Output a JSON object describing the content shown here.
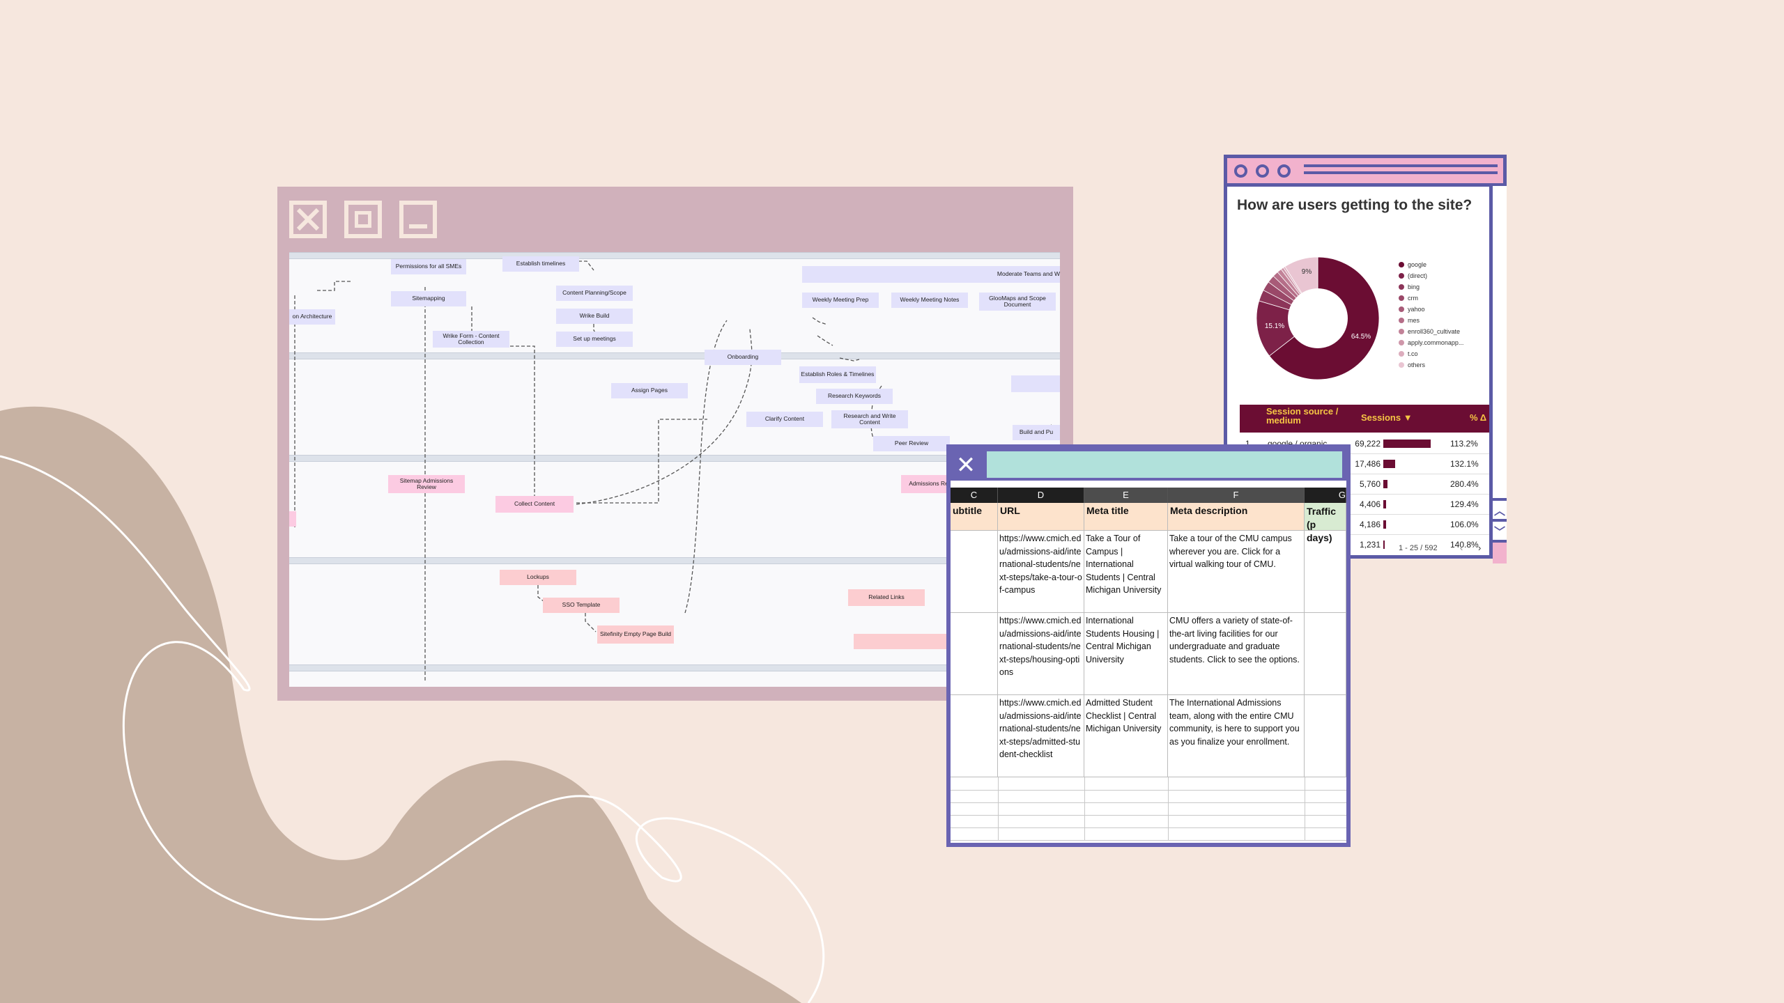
{
  "colors": {
    "background": "#f6e7de",
    "blob": "#c7b2a3",
    "window1_frame": "#d0b1bb",
    "window_border": "#5b5aa6",
    "pie_dark": "#6b0d33",
    "table_header_text": "#f6c644",
    "teal": "#b1e1db"
  },
  "flowchart": {
    "nodes": [
      "Permissions for all SMEs",
      "Establish timelines",
      "Moderate Teams and W",
      "on Architecture",
      "Sitemapping",
      "Content Planning/Scope",
      "Wrike Build",
      "Wrike Form - Content Collection",
      "Set up meetings",
      "Weekly Meeting Prep",
      "Weekly Meeting Notes",
      "GlooMaps and Scope Document",
      "Onboarding",
      "Assign Pages",
      "Establish Roles & Timelines",
      "Research Keywords",
      "Clarify Content",
      "Research and Write Content",
      "Build and Pu",
      "Peer Review",
      "Sitemap Admissions Review",
      "Collect Content",
      "Admissions Revie",
      "Lockups",
      "SSO Template",
      "Sitefinity Empty Page Build",
      "Related Links"
    ]
  },
  "analytics": {
    "title": "How are users getting to the site?",
    "legend": [
      "google",
      "(direct)",
      "bing",
      "crm",
      "yahoo",
      "mes",
      "enroll360_cultivate",
      "apply.commonapp...",
      "t.co",
      "others"
    ],
    "table": {
      "headers": [
        "Session source / medium",
        "Sessions ▼",
        "% Δ"
      ],
      "rows": [
        {
          "idx": "1.",
          "source": "google / organic",
          "sessions": "69,222",
          "pct": "113.2%"
        },
        {
          "idx": "",
          "source": "",
          "sessions": "17,486",
          "pct": "132.1%"
        },
        {
          "idx": "",
          "source": "",
          "sessions": "5,760",
          "pct": "280.4%"
        },
        {
          "idx": "",
          "source": "",
          "sessions": "4,406",
          "pct": "129.4%"
        },
        {
          "idx": "",
          "source": "",
          "sessions": "4,186",
          "pct": "106.0%"
        },
        {
          "idx": "",
          "source": "",
          "sessions": "1,231",
          "pct": "140.8%"
        }
      ],
      "pagination": "1 - 25 / 592"
    }
  },
  "chart_data": {
    "type": "pie",
    "title": "How are users getting to the site?",
    "categories": [
      "google",
      "(direct)",
      "bing",
      "crm",
      "yahoo",
      "mes",
      "enroll360_cultivate",
      "apply.commonapp...",
      "t.co",
      "others"
    ],
    "values": [
      64.5,
      15.1,
      3.0,
      2.5,
      2.0,
      1.5,
      1.2,
      0.7,
      0.5,
      9.0
    ],
    "data_labels": [
      "64.5%",
      "15.1%",
      "9%"
    ],
    "legend_position": "right"
  },
  "spreadsheet": {
    "columns": [
      "C",
      "D",
      "E",
      "F",
      "G"
    ],
    "field_headers": [
      "ubtitle",
      "URL",
      "Meta title",
      "Meta description",
      "Traffic (p days)"
    ],
    "rows": [
      {
        "url": "https://www.cmich.edu/admissions-aid/international-students/next-steps/take-a-tour-of-campus",
        "meta_title": "Take a Tour of Campus | International Students | Central Michigan University",
        "meta_description": "Take a tour of the CMU campus wherever you are. Click for a virtual walking tour of CMU."
      },
      {
        "url": "https://www.cmich.edu/admissions-aid/international-students/next-steps/housing-options",
        "meta_title": "International Students Housing | Central Michigan University",
        "meta_description": "CMU offers a variety of state-of-the-art living facilities for our undergraduate and graduate students. Click to see the options."
      },
      {
        "url": "https://www.cmich.edu/admissions-aid/international-students/next-steps/admitted-student-checklist",
        "meta_title": "Admitted Student Checklist | Central Michigan University",
        "meta_description": "The International Admissions team, along with the entire CMU community, is here to support you as you finalize your enrollment."
      }
    ]
  }
}
